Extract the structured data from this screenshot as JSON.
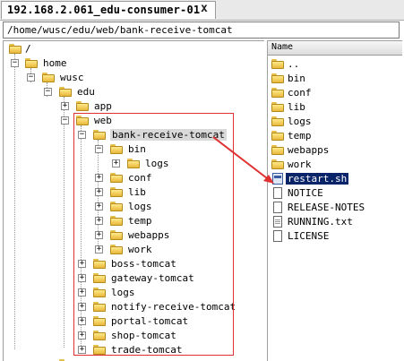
{
  "tab": {
    "title": "192.168.2.061_edu-consumer-01",
    "close_label": "x"
  },
  "path": "/home/wusc/edu/web/bank-receive-tomcat",
  "tree": {
    "root": "/",
    "home": "home",
    "wusc": "wusc",
    "edu": "edu",
    "app": "app",
    "web": "web",
    "bank_receive_tomcat": "bank-receive-tomcat",
    "bin": "bin",
    "bin_logs": "logs",
    "conf": "conf",
    "lib": "lib",
    "logs": "logs",
    "temp": "temp",
    "webapps": "webapps",
    "work": "work",
    "siblings": [
      "boss-tomcat",
      "gateway-tomcat",
      "logs",
      "notify-receive-tomcat",
      "portal-tomcat",
      "shop-tomcat",
      "trade-tomcat"
    ]
  },
  "file_list": {
    "column_name": "Name",
    "folders": [
      "..",
      "bin",
      "conf",
      "lib",
      "logs",
      "temp",
      "webapps",
      "work"
    ],
    "files": [
      "restart.sh",
      "NOTICE",
      "RELEASE-NOTES",
      "RUNNING.txt",
      "LICENSE"
    ]
  },
  "colors": {
    "highlight_box": "#e03030",
    "selection": "#0a246a",
    "folder": "#f2cf5b"
  }
}
